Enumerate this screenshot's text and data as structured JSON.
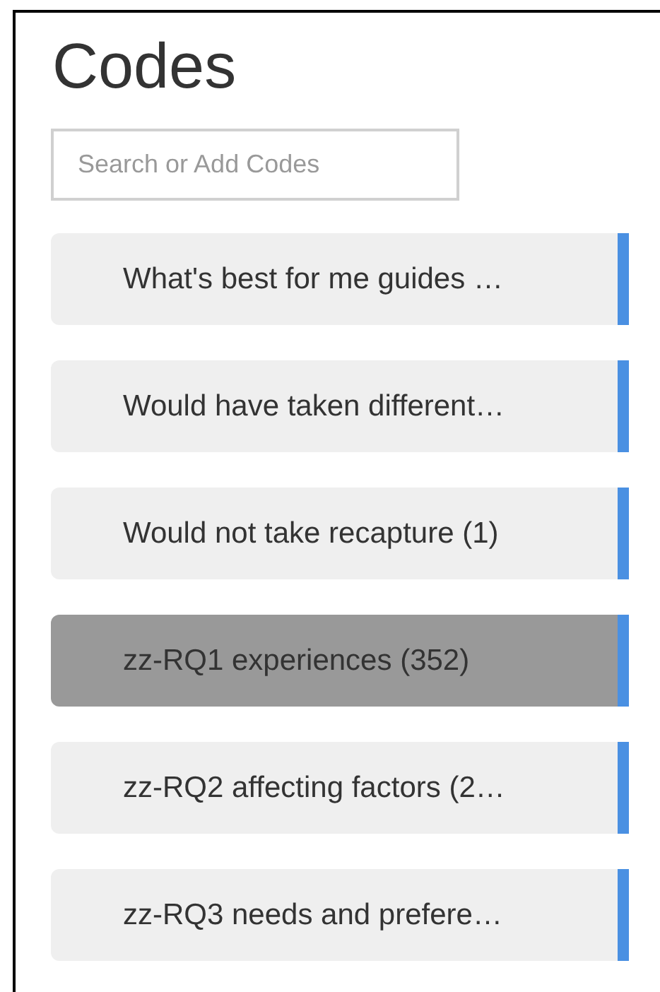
{
  "title": "Codes",
  "search": {
    "placeholder": "Search or Add Codes"
  },
  "codes": [
    {
      "label": "What's best for me guides …",
      "selected": false
    },
    {
      "label": "Would have taken different…",
      "selected": false
    },
    {
      "label": "Would not take recapture (1)",
      "selected": false
    },
    {
      "label": "zz-RQ1 experiences (352)",
      "selected": true
    },
    {
      "label": "zz-RQ2 affecting factors (2…",
      "selected": false
    },
    {
      "label": "zz-RQ3 needs and prefere…",
      "selected": false
    }
  ]
}
